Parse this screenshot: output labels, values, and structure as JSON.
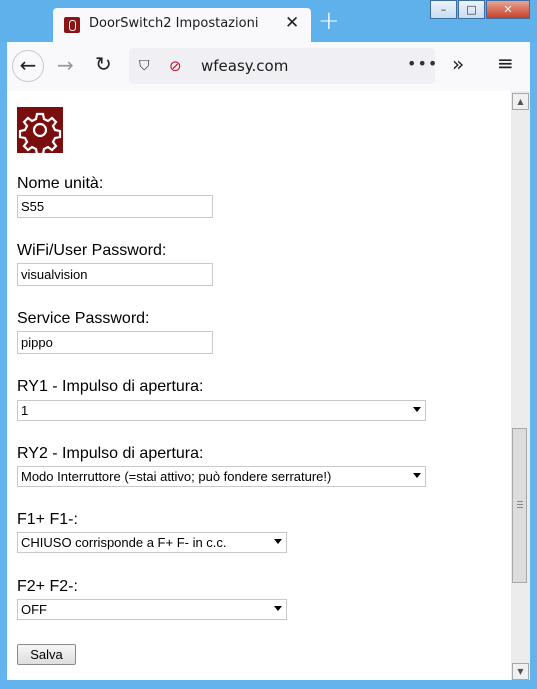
{
  "tab": {
    "title": "DoorSwitch2 Impostazioni",
    "favicon": "door-switch-icon"
  },
  "toolbar": {
    "url": "wfeasy.com"
  },
  "form": {
    "unit_name_label": "Nome unità:",
    "unit_name_value": "S55",
    "wifi_password_label": "WiFi/User Password:",
    "wifi_password_value": "visualvision",
    "service_password_label": "Service Password:",
    "service_password_value": "pippo",
    "ry1_label": "RY1 - Impulso di apertura:",
    "ry1_value": "1",
    "ry2_label": "RY2 - Impulso di apertura:",
    "ry2_value": "Modo Interruttore (=stai attivo; può fondere serrature!)",
    "f1_label": "F1+ F1-:",
    "f1_value": "CHIUSO corrisponde a F+ F- in c.c.",
    "f2_label": "F2+ F2-:",
    "f2_value": "OFF",
    "save_label": "Salva"
  },
  "colors": {
    "accent": "#7a0d0d",
    "chrome": "#5fb1ec"
  }
}
